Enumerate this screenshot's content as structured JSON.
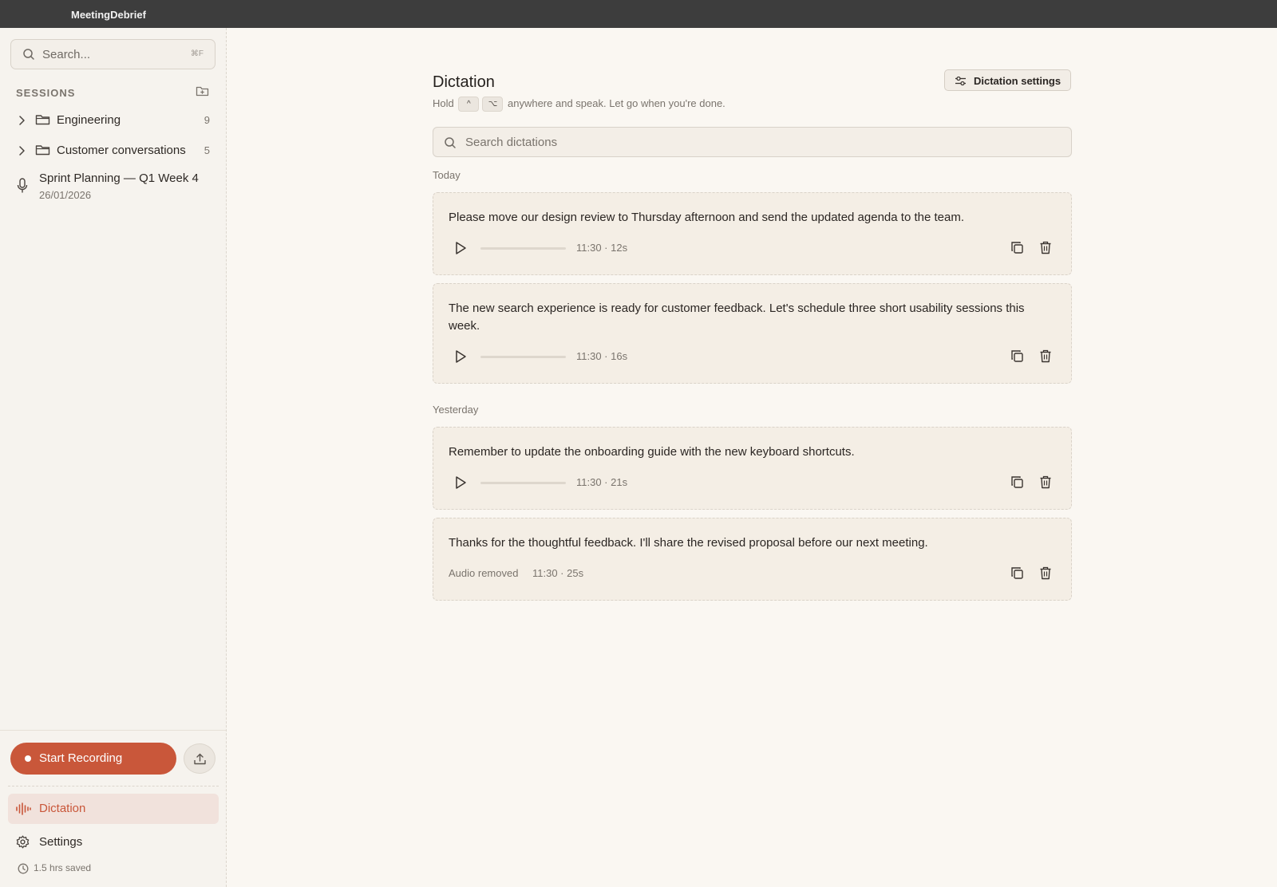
{
  "app": {
    "title": "MeetingDebrief"
  },
  "sidebar": {
    "search_placeholder": "Search...",
    "search_shortcut": "⌘F",
    "sessions_header": "SESSIONS",
    "folders": [
      {
        "label": "Engineering",
        "count": "9"
      },
      {
        "label": "Customer conversations",
        "count": "5"
      }
    ],
    "session": {
      "title": "Sprint Planning — Q1 Week 4",
      "date": "26/01/2026"
    },
    "record_label": "Start Recording",
    "nav": [
      {
        "label": "Dictation",
        "active": true
      },
      {
        "label": "Settings",
        "active": false
      }
    ],
    "saved": "1.5 hrs saved"
  },
  "main": {
    "title": "Dictation",
    "subtitle": {
      "prefix": "Hold",
      "key1": "^",
      "key2": "⌥",
      "suffix": "anywhere and speak. Let go when you're done."
    },
    "settings_button": "Dictation settings",
    "search_placeholder": "Search dictations",
    "groups": [
      {
        "label": "Today",
        "items": [
          {
            "text": "Please move our design review to Thursday afternoon and send the updated agenda to the team.",
            "meta": "11:30 · 12s",
            "has_audio": true
          },
          {
            "text": "The new search experience is ready for customer feedback. Let's schedule three short usability sessions this week.",
            "meta": "11:30 · 16s",
            "has_audio": true
          }
        ]
      },
      {
        "label": "Yesterday",
        "items": [
          {
            "text": "Remember to update the onboarding guide with the new keyboard shortcuts.",
            "meta": "11:30 · 21s",
            "has_audio": true
          },
          {
            "text": "Thanks for the thoughtful feedback. I'll share the revised proposal before our next meeting.",
            "meta": "11:30 · 25s",
            "has_audio": false,
            "audio_status": "Audio removed"
          }
        ]
      }
    ]
  },
  "colors": {
    "accent": "#c9573a",
    "titlebar": "#3d3d3d",
    "background": "#faf7f2",
    "card": "#f4eee5"
  }
}
